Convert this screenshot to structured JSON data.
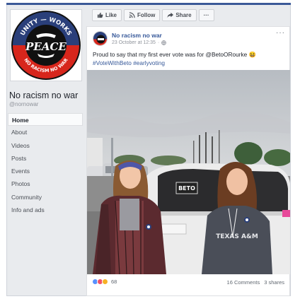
{
  "page": {
    "name": "No racism no war",
    "handle": "@nornowar",
    "logo_text_top": "UNITY — WORKS",
    "logo_text_center": "PEACE",
    "logo_text_bottom": "NO RACISM NO WAR"
  },
  "nav": {
    "items": [
      {
        "label": "Home",
        "active": true
      },
      {
        "label": "About"
      },
      {
        "label": "Videos"
      },
      {
        "label": "Posts"
      },
      {
        "label": "Events"
      },
      {
        "label": "Photos"
      },
      {
        "label": "Community"
      },
      {
        "label": "Info and ads"
      }
    ]
  },
  "actions": {
    "like": "Like",
    "follow": "Follow",
    "share": "Share",
    "more": "···"
  },
  "post": {
    "author": "No racism no war",
    "timestamp": "23 October at 12:35",
    "separator": "·",
    "text": "Proud to say that my first ever vote was for @BetoORourke 😆",
    "hashtags": "#VoteWithBeto #earlyvoting",
    "reaction_count": "68",
    "comments": "16 Comments",
    "shares": "3 shares",
    "photo_sign": "BETO",
    "shirt_text": "TEXAS A&M"
  },
  "colors": {
    "brand": "#3b5998",
    "link": "#365899",
    "logo_red": "#d7261c",
    "logo_blue": "#2a3f7a"
  }
}
